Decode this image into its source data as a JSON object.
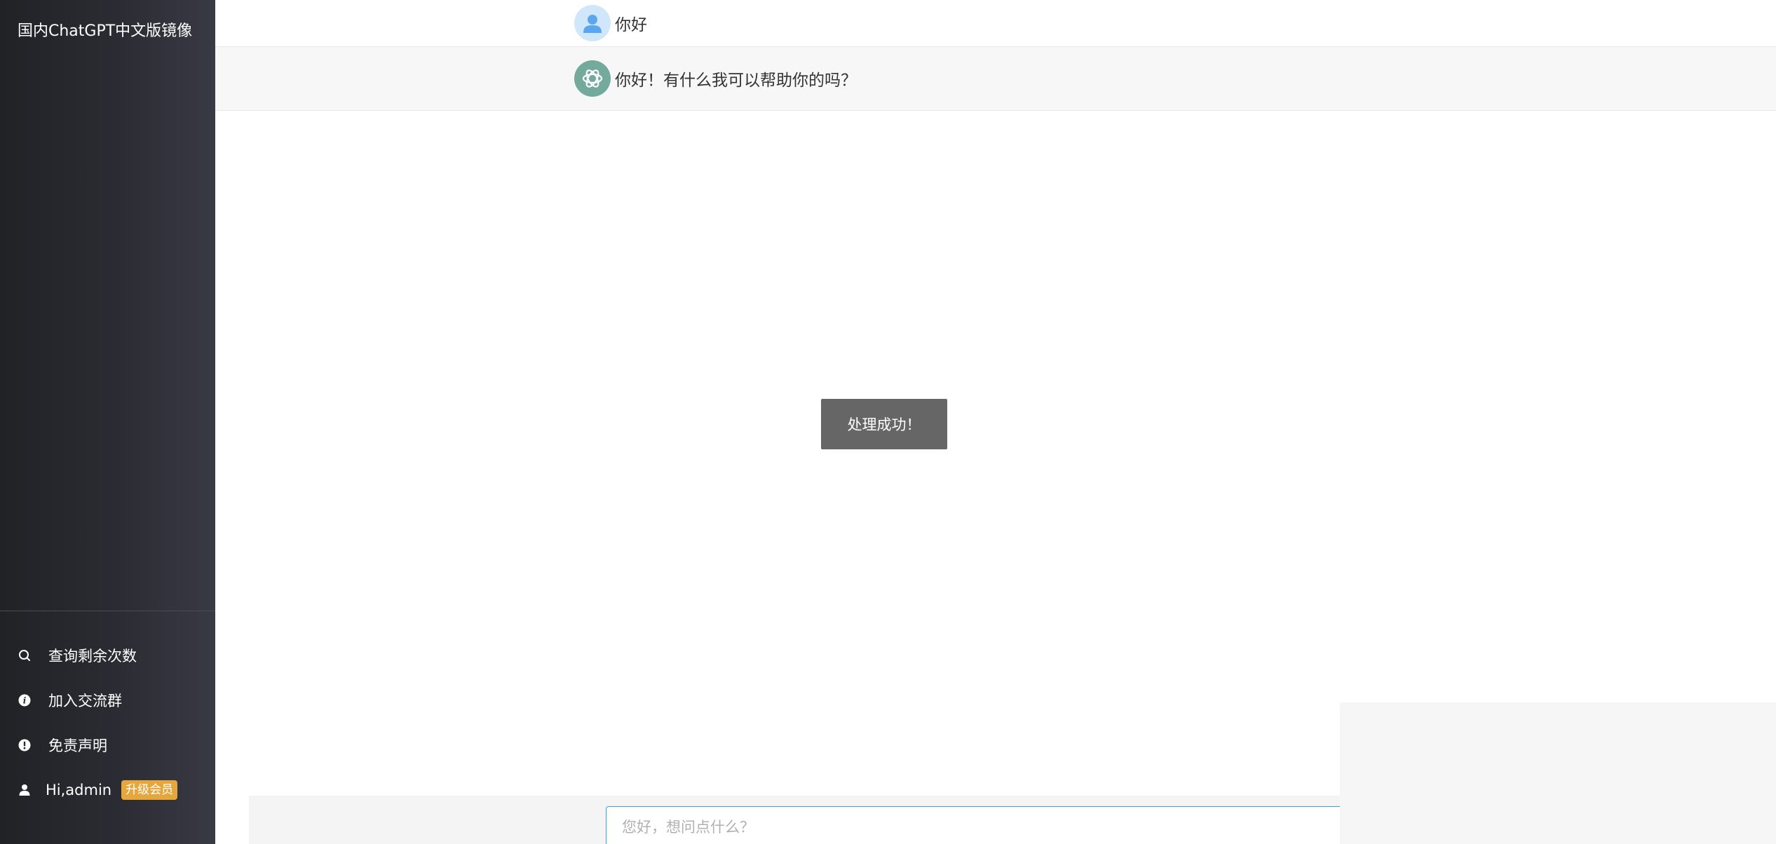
{
  "sidebar": {
    "brand": "国内ChatGPT中文版镜像",
    "menu": [
      {
        "label": "查询剩余次数",
        "icon": "search-icon"
      },
      {
        "label": "加入交流群",
        "icon": "info-icon"
      },
      {
        "label": "免责声明",
        "icon": "exclamation-icon"
      }
    ],
    "user": {
      "label": "Hi,admin",
      "badge": "升级会员",
      "icon": "user-icon"
    }
  },
  "chat": {
    "messages": [
      {
        "role": "user",
        "text": "你好"
      },
      {
        "role": "assistant",
        "text": "你好！有什么我可以帮助你的吗？"
      }
    ]
  },
  "toast": {
    "text": "处理成功！"
  },
  "input": {
    "placeholder": "您好，想问点什么？",
    "value": ""
  },
  "colors": {
    "sidebar_bg": "#2b2c33",
    "badge": "#e5a63b",
    "bot_avatar": "#74aa9c",
    "user_avatar": "#cfe6fb",
    "input_border": "#3e9be6",
    "toast_bg": "#666666"
  }
}
